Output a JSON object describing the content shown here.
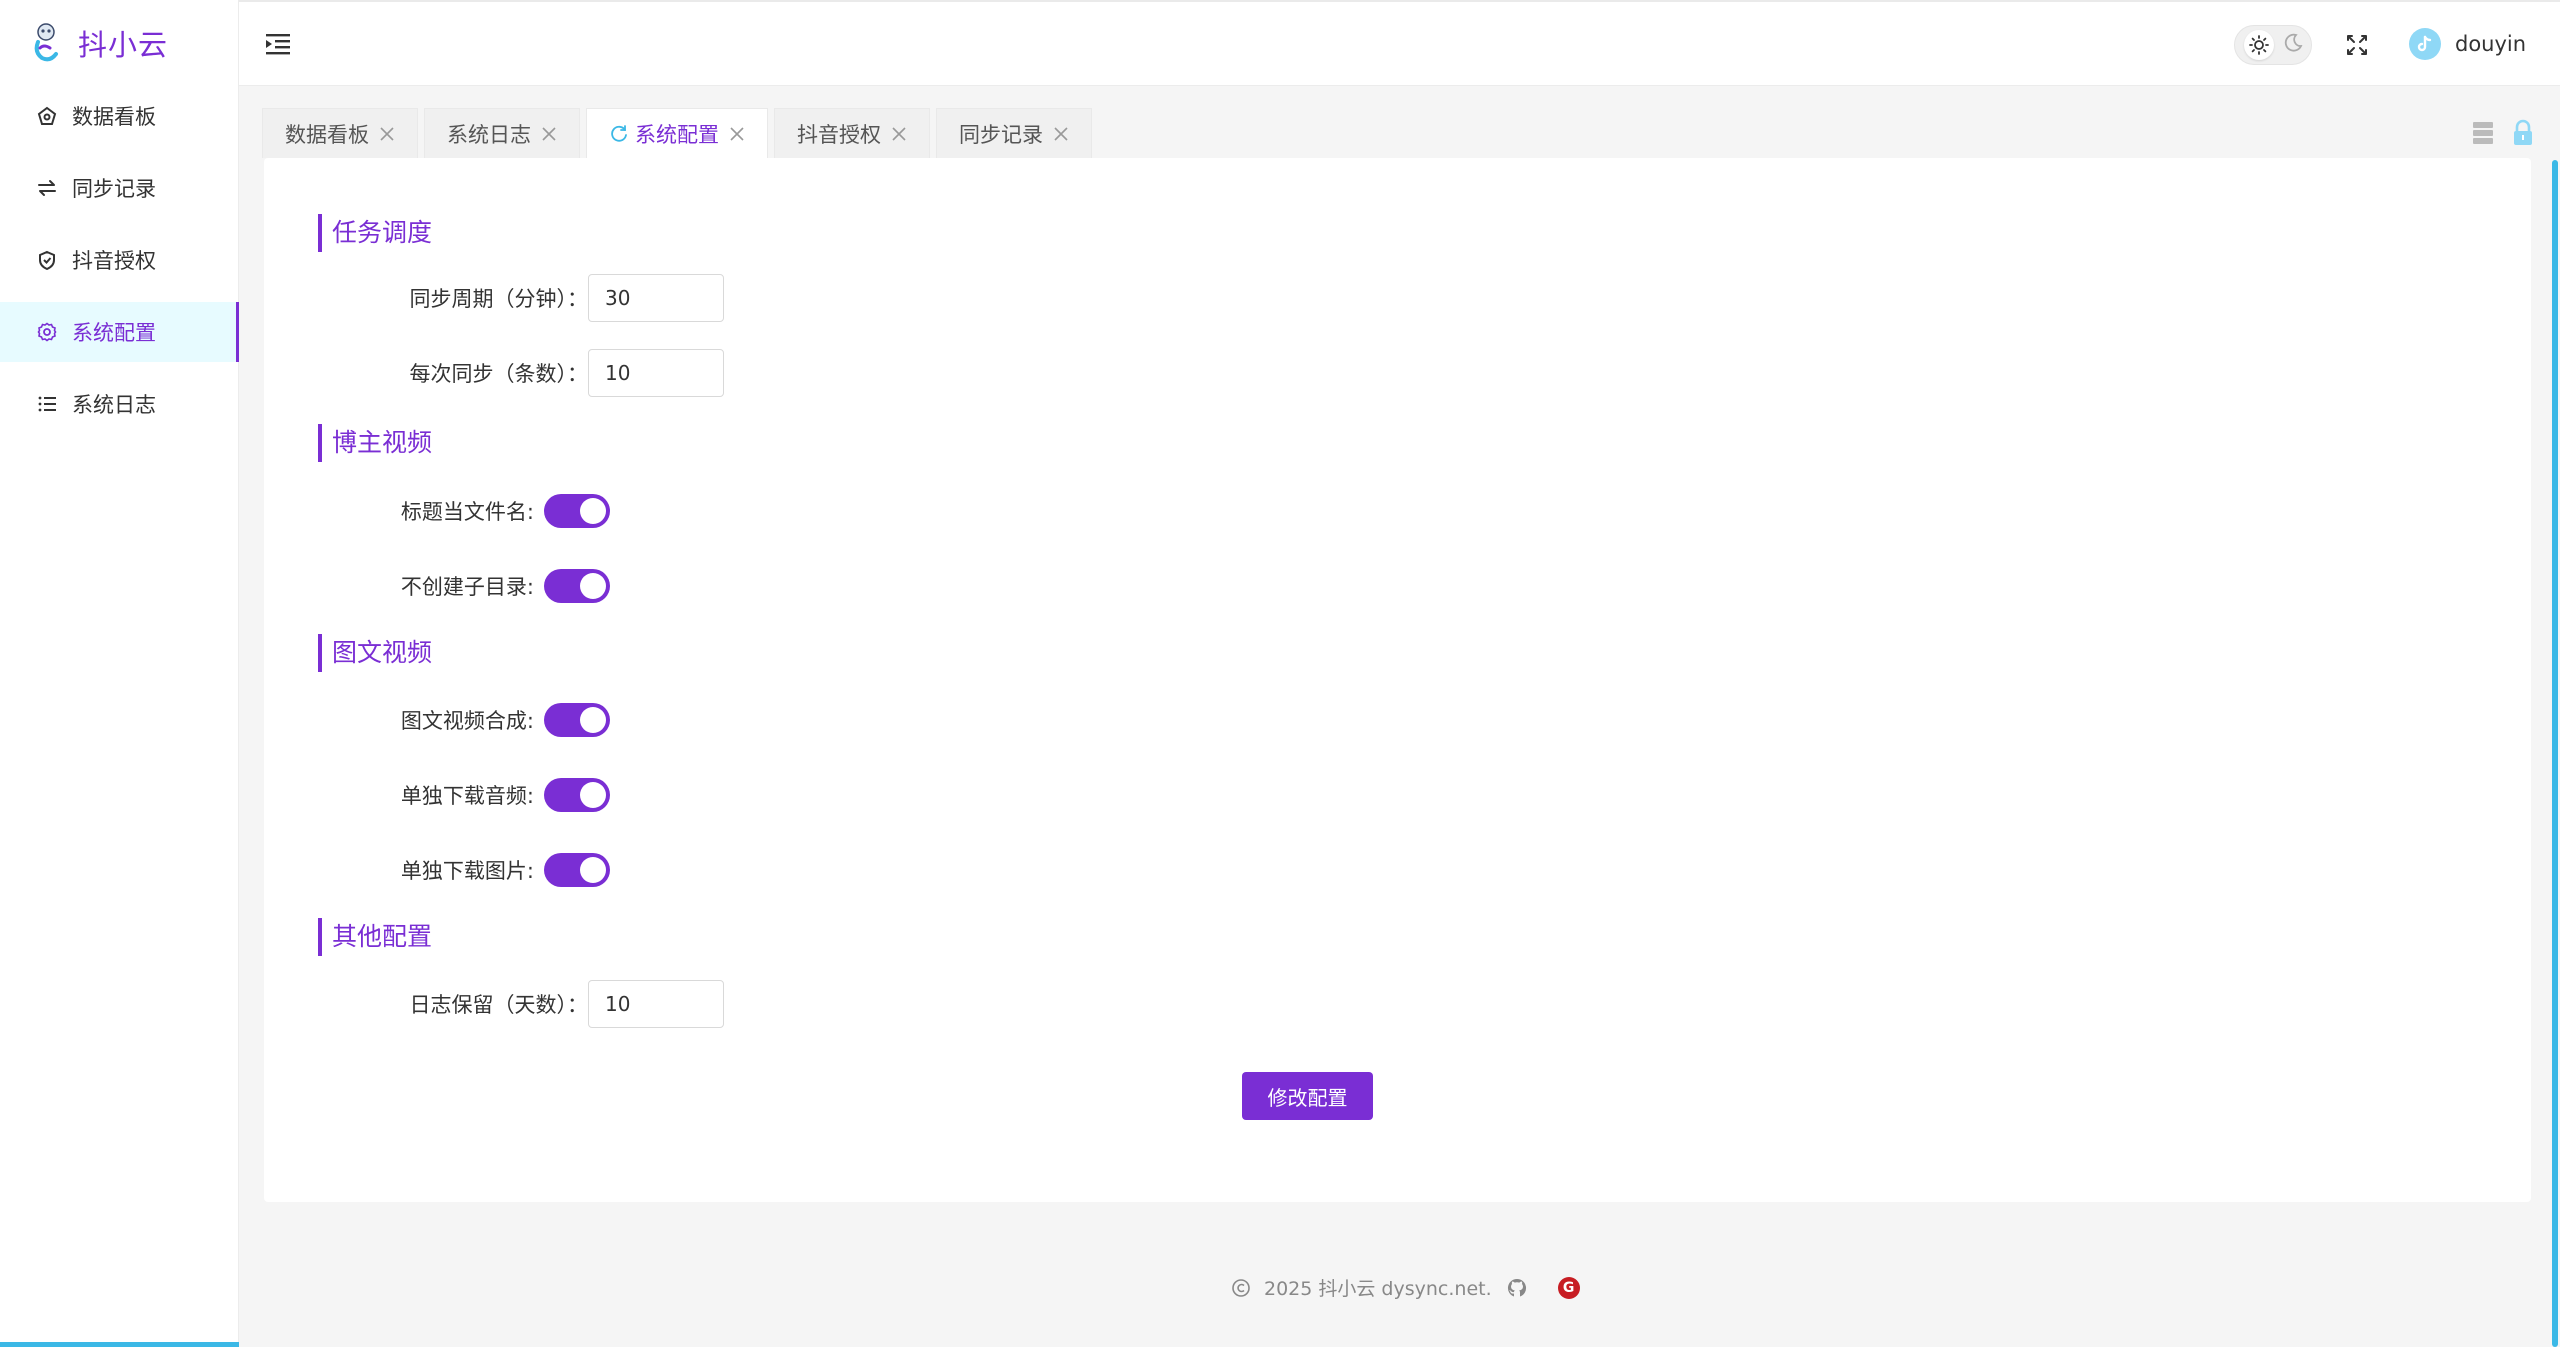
{
  "brand": {
    "name": "抖小云"
  },
  "sidebar": {
    "items": [
      {
        "label": "数据看板",
        "icon": "dashboard-icon"
      },
      {
        "label": "同步记录",
        "icon": "sync-arrows-icon"
      },
      {
        "label": "抖音授权",
        "icon": "shield-check-icon"
      },
      {
        "label": "系统配置",
        "icon": "gear-icon",
        "active": true
      },
      {
        "label": "系统日志",
        "icon": "list-icon"
      }
    ]
  },
  "header": {
    "username": "douyin",
    "theme": "light"
  },
  "tabs": [
    {
      "label": "数据看板"
    },
    {
      "label": "系统日志"
    },
    {
      "label": "系统配置",
      "active": true
    },
    {
      "label": "抖音授权"
    },
    {
      "label": "同步记录"
    }
  ],
  "sections": {
    "task": {
      "title": "任务调度",
      "sync_period_label": "同步周期（分钟）：",
      "sync_period_value": "30",
      "per_sync_label": "每次同步（条数）：",
      "per_sync_value": "10"
    },
    "blogger": {
      "title": "博主视频",
      "title_as_filename_label": "标题当文件名:",
      "title_as_filename_on": true,
      "no_subdir_label": "不创建子目录:",
      "no_subdir_on": true
    },
    "image_video": {
      "title": "图文视频",
      "compose_label": "图文视频合成:",
      "compose_on": true,
      "audio_label": "单独下载音频:",
      "audio_on": true,
      "image_label": "单独下载图片:",
      "image_on": true
    },
    "other": {
      "title": "其他配置",
      "log_keep_label": "日志保留（天数）：",
      "log_keep_value": "10"
    }
  },
  "submit_label": "修改配置",
  "footer": {
    "text": "2025 抖小云 dysync.net.",
    "gitee_letter": "G"
  },
  "colors": {
    "accent": "#7a2ed4",
    "active_bg": "#e7fbff",
    "scrollbar": "#3bb8e6"
  }
}
